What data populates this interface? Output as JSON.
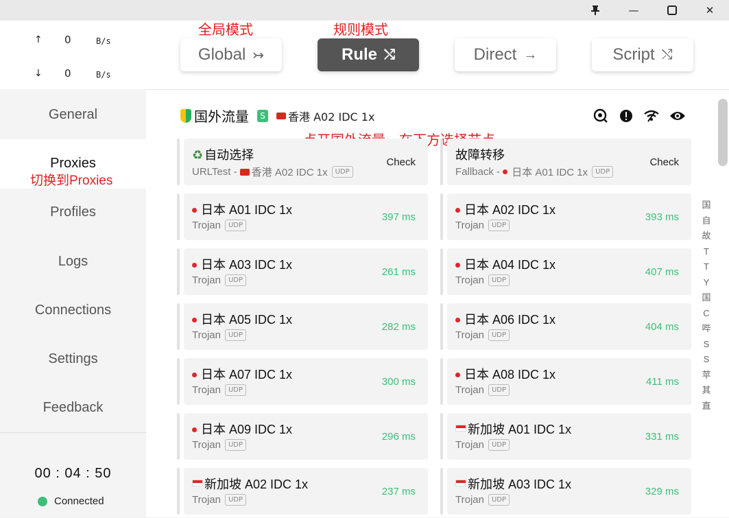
{
  "window": {
    "pin_icon": "pin-icon",
    "minimize_glyph": "—",
    "maximize_glyph": "▢",
    "close_glyph": "✕"
  },
  "traffic": {
    "up_arrow": "↑",
    "up_value": "0",
    "up_unit": "B/s",
    "down_arrow": "↓",
    "down_value": "0",
    "down_unit": "B/s"
  },
  "nav": {
    "general": "General",
    "proxies": "Proxies",
    "profiles": "Profiles",
    "logs": "Logs",
    "connections": "Connections",
    "settings": "Settings",
    "feedback": "Feedback"
  },
  "footer": {
    "timer": "00 : 04 : 50",
    "status": "Connected",
    "status_color": "#3bbf7a"
  },
  "modes": {
    "global": {
      "label": "Global",
      "icon": "↣"
    },
    "rule": {
      "label": "Rule",
      "icon": "⤭"
    },
    "direct": {
      "label": "Direct",
      "icon": "→"
    },
    "script": {
      "label": "Script",
      "icon": "⤭"
    },
    "active": "Rule"
  },
  "annotations": {
    "global": "全局模式",
    "rule": "规则模式",
    "proxies": "切换到Proxies",
    "group": "点开国外流量，在下方选择节点"
  },
  "group": {
    "name": "国外流量",
    "badge": "S",
    "selected": "香港 A02 IDC 1x"
  },
  "toolbar_icons": [
    "speed-test-icon",
    "alert-icon",
    "wifi-icon",
    "eye-icon"
  ],
  "proxies": [
    {
      "name": "自动选择",
      "type": "URLTest - ",
      "sub_name": "香港 A02 IDC 1x",
      "udp": "UDP",
      "action": "Check",
      "flag": "recycle"
    },
    {
      "name": "故障转移",
      "type": "Fallback - ",
      "sub_name": "日本 A01 IDC 1x",
      "udp": "UDP",
      "action": "Check",
      "flag": "none"
    },
    {
      "name": "日本 A01 IDC 1x",
      "type": "Trojan",
      "udp": "UDP",
      "delay": "397 ms",
      "flag": "jp"
    },
    {
      "name": "日本 A02 IDC 1x",
      "type": "Trojan",
      "udp": "UDP",
      "delay": "393 ms",
      "flag": "jp"
    },
    {
      "name": "日本 A03 IDC 1x",
      "type": "Trojan",
      "udp": "UDP",
      "delay": "261 ms",
      "flag": "jp"
    },
    {
      "name": "日本 A04 IDC 1x",
      "type": "Trojan",
      "udp": "UDP",
      "delay": "407 ms",
      "flag": "jp"
    },
    {
      "name": "日本 A05 IDC 1x",
      "type": "Trojan",
      "udp": "UDP",
      "delay": "282 ms",
      "flag": "jp"
    },
    {
      "name": "日本 A06 IDC 1x",
      "type": "Trojan",
      "udp": "UDP",
      "delay": "404 ms",
      "flag": "jp"
    },
    {
      "name": "日本 A07 IDC 1x",
      "type": "Trojan",
      "udp": "UDP",
      "delay": "300 ms",
      "flag": "jp"
    },
    {
      "name": "日本 A08 IDC 1x",
      "type": "Trojan",
      "udp": "UDP",
      "delay": "411 ms",
      "flag": "jp"
    },
    {
      "name": "日本 A09 IDC 1x",
      "type": "Trojan",
      "udp": "UDP",
      "delay": "296 ms",
      "flag": "jp"
    },
    {
      "name": "新加坡 A01 IDC 1x",
      "type": "Trojan",
      "udp": "UDP",
      "delay": "331 ms",
      "flag": "sg"
    },
    {
      "name": "新加坡 A02 IDC 1x",
      "type": "Trojan",
      "udp": "UDP",
      "delay": "237 ms",
      "flag": "sg"
    },
    {
      "name": "新加坡 A03 IDC 1x",
      "type": "Trojan",
      "udp": "UDP",
      "delay": "329 ms",
      "flag": "sg"
    }
  ],
  "index_rail": [
    "国",
    "自",
    "故",
    "T",
    "T",
    "Y",
    "国",
    "C",
    "哔",
    "S",
    "S",
    "苹",
    "其",
    "直"
  ]
}
